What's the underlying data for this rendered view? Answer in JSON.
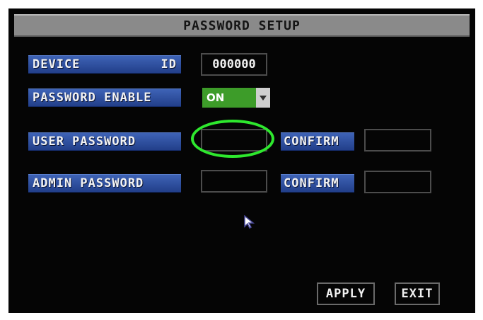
{
  "title": "PASSWORD SETUP",
  "device_id": {
    "label_left": "DEVICE",
    "label_right": "ID",
    "value": "000000"
  },
  "password_enable": {
    "label": "PASSWORD ENABLE",
    "selected": "ON"
  },
  "user_password": {
    "label": "USER PASSWORD",
    "value": "",
    "confirm_label": "CONFIRM",
    "confirm_value": ""
  },
  "admin_password": {
    "label": "ADMIN PASSWORD",
    "value": "",
    "confirm_label": "CONFIRM",
    "confirm_value": ""
  },
  "buttons": {
    "apply": "APPLY",
    "exit": "EXIT"
  },
  "colors": {
    "label_bg": "#2f52a8",
    "highlight_ellipse": "#2ee82e",
    "select_bg": "#3d9c29",
    "title_bg": "#8a8a8a"
  },
  "icons": {
    "dropdown": "triangle-down-icon",
    "pointer": "mouse-pointer-icon"
  }
}
